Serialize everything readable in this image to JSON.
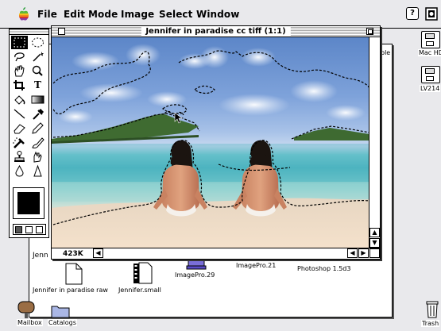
{
  "menubar": {
    "items": [
      "File",
      "Edit",
      "Mode",
      "Image",
      "Select",
      "Window"
    ],
    "help_glyph": "?"
  },
  "image_window": {
    "title": "Jennifer in paradise cc tiff (1:1)",
    "doc_size": "423K"
  },
  "finder": {
    "partial_label_left": "Jenn",
    "partial_label_right": "ble",
    "items": [
      {
        "label": "Jennifer in paradise raw",
        "icon": "document-icon"
      },
      {
        "label": "Jennifer.small",
        "icon": "film-document-icon"
      },
      {
        "label": "ImagePro.29",
        "icon": "app-icon"
      },
      {
        "label": "ImagePro.21",
        "icon": "app-icon"
      },
      {
        "label": "Photoshop 1.5d3",
        "icon": "app-icon"
      }
    ]
  },
  "desktop": {
    "disks": [
      {
        "label": "Mac HD"
      },
      {
        "label": "LV214"
      }
    ],
    "bottom_left": [
      "Mailbox",
      "Catalogs"
    ],
    "trash": "Trash"
  },
  "toolbox": {
    "tools": [
      "marquee-rect",
      "marquee-ellipse",
      "lasso",
      "magic-wand",
      "hand",
      "zoom",
      "crop",
      "text",
      "paint-bucket",
      "gradient",
      "line",
      "eyedropper",
      "eraser",
      "pencil",
      "airbrush",
      "brush",
      "stamp",
      "smudge",
      "blur",
      "sharpen"
    ]
  }
}
